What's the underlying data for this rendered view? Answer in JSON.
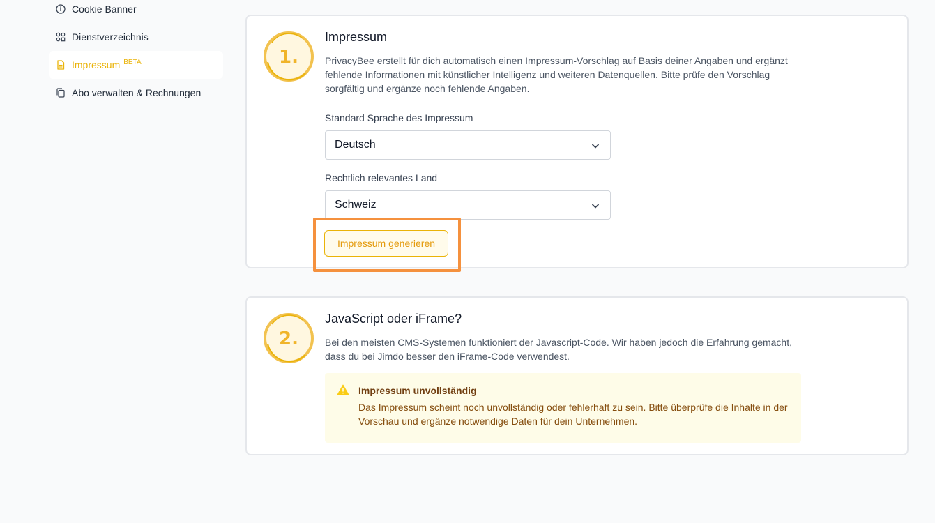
{
  "sidebar": {
    "items": [
      {
        "label": "Cookie Banner",
        "icon": "info-icon"
      },
      {
        "label": "Dienstverzeichnis",
        "icon": "grid-icon"
      },
      {
        "label": "Impressum",
        "badge": "BETA",
        "icon": "document-icon",
        "active": true
      },
      {
        "label": "Abo verwalten & Rechnungen",
        "icon": "copy-icon"
      }
    ]
  },
  "step1": {
    "number": "1.",
    "title": "Impressum",
    "description": "PrivacyBee erstellt für dich automatisch einen Impressum-Vorschlag auf Basis deiner Angaben und ergänzt fehlende Informationen mit künstlicher Intelligenz und weiteren Datenquellen. Bitte prüfe den Vorschlag sorgfältig und ergänze noch fehlende Angaben.",
    "language_label": "Standard Sprache des Impressum",
    "language_value": "Deutsch",
    "country_label": "Rechtlich relevantes Land",
    "country_value": "Schweiz",
    "generate_button": "Impressum generieren"
  },
  "step2": {
    "number": "2.",
    "title": "JavaScript oder iFrame?",
    "description": "Bei den meisten CMS-Systemen funktioniert der Javascript-Code. Wir haben jedoch die Erfahrung gemacht, dass du bei Jimdo besser den iFrame-Code verwendest.",
    "alert_title": "Impressum unvollständig",
    "alert_text": "Das Impressum scheint noch unvollständig oder fehlerhaft zu sein. Bitte überprüfe die Inhalte in der Vorschau und ergänze notwendige Daten für dein Unternehmen."
  },
  "colors": {
    "accent": "#eab308",
    "highlight": "#f5913e",
    "alert_bg": "#fefce8"
  }
}
